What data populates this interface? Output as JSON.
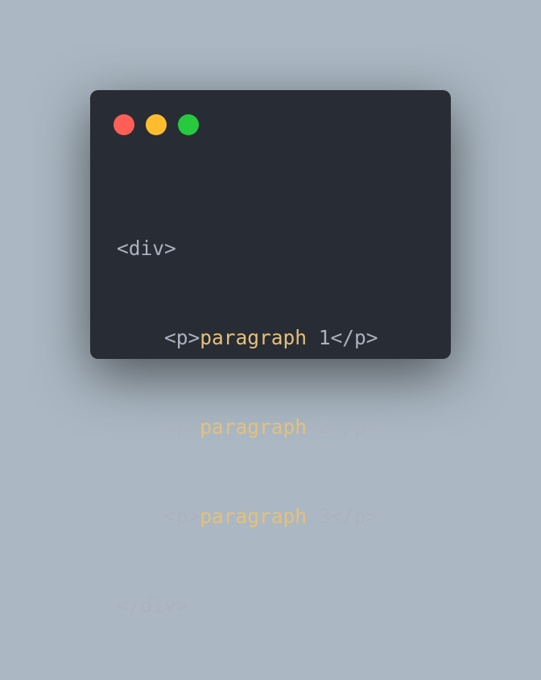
{
  "window": {
    "controls": {
      "close_icon": "red-circle",
      "minimize_icon": "yellow-circle",
      "maximize_icon": "green-circle",
      "close_color": "#ff5f56",
      "minimize_color": "#ffbd2e",
      "maximize_color": "#27c93f"
    }
  },
  "colors": {
    "page_background": "#abb8c3",
    "window_background": "#282c34",
    "tag_color": "#abb2bf",
    "text_color": "#e5c07b"
  },
  "code": {
    "line1": {
      "tag": "<div>"
    },
    "line2": {
      "indent": "    ",
      "open": "<p>",
      "text": "paragraph",
      "rest": " 1</p>"
    },
    "line3": {
      "indent": "    ",
      "open": "<p>",
      "text": "paragraph",
      "rest": " 2</p>"
    },
    "line4": {
      "indent": "    ",
      "open": "<p>",
      "text": "paragraph",
      "rest": " 3</p>"
    },
    "line5": {
      "tag": "</div>"
    }
  }
}
